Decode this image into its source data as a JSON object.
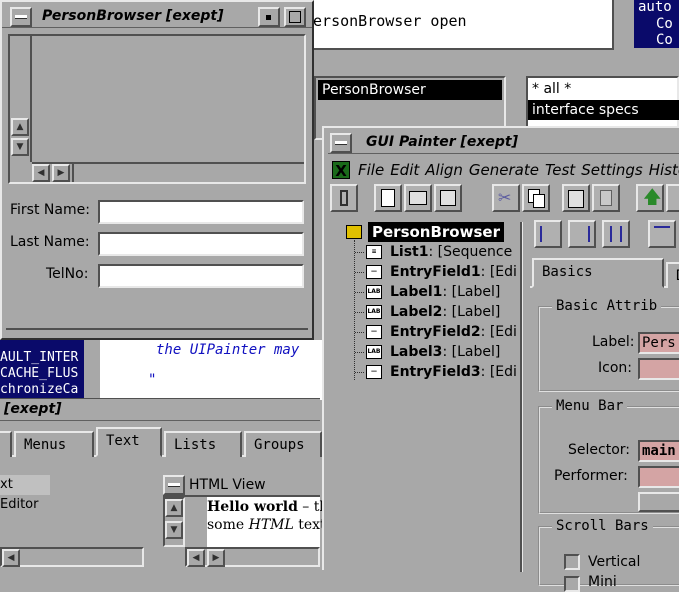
{
  "background": {
    "command_text": "PersonBrowser open",
    "auto_text": "auto",
    "autoc_text": "Co",
    "autoc2_text": "Co",
    "browser_list": {
      "selected": "PersonBrowser"
    },
    "protocol_list": {
      "items": [
        "* all *",
        "interface specs"
      ]
    },
    "code_lines": [
      "the UIPainter may",
      "\""
    ],
    "left_code": [
      "AULT_INTER",
      "CACHE_FLUS",
      "chronizeCa"
    ]
  },
  "person_browser": {
    "title": "PersonBrowser [exept]",
    "fields": [
      {
        "label": "First Name:",
        "value": ""
      },
      {
        "label": "Last Name:",
        "value": ""
      },
      {
        "label": "TelNo:",
        "value": ""
      }
    ]
  },
  "lower_window": {
    "title": "[exept]",
    "tabs": [
      "Menus",
      "Text",
      "Lists",
      "Groups"
    ],
    "active_tab": "Text",
    "text_editor_label": "xt Editor",
    "html_view": {
      "label": "HTML View",
      "line1_bold": "Hello world",
      "line1_rest": " – th",
      "line2_a": "some ",
      "line2_em": "HTML",
      "line2_b": " text"
    }
  },
  "gui_painter": {
    "title": "GUI Painter [exept]",
    "menu_icon": "x-logo-icon",
    "menu": [
      "File",
      "Edit",
      "Align",
      "Generate",
      "Test",
      "Settings",
      "Histor"
    ],
    "tree": [
      {
        "name": "PersonBrowser",
        "type": "",
        "icon": "window-icon",
        "selected": true
      },
      {
        "name": "List1",
        "type": ": [Sequence",
        "icon": "list-icon"
      },
      {
        "name": "EntryField1",
        "type": ": [Edi",
        "icon": "entryfield-icon"
      },
      {
        "name": "Label1",
        "type": ": [Label]",
        "icon": "label-icon"
      },
      {
        "name": "Label2",
        "type": ": [Label]",
        "icon": "label-icon"
      },
      {
        "name": "EntryField2",
        "type": ": [Edi",
        "icon": "entryfield-icon"
      },
      {
        "name": "Label3",
        "type": ": [Label]",
        "icon": "label-icon"
      },
      {
        "name": "EntryField3",
        "type": ": [Edi",
        "icon": "entryfield-icon"
      }
    ],
    "icon_glyph": "LAB",
    "tabs": [
      "Basics",
      "D"
    ],
    "basic_attributes": {
      "title": "Basic Attrib",
      "label_label": "Label:",
      "label_value": "Pers",
      "icon_label": "Icon:"
    },
    "menu_bar": {
      "title": "Menu Bar",
      "selector_label": "Selector:",
      "selector_value": "main",
      "performer_label": "Performer:"
    },
    "scroll_bars": {
      "title": "Scroll Bars",
      "vertical_label": "Vertical",
      "mini_label": "Mini"
    }
  }
}
